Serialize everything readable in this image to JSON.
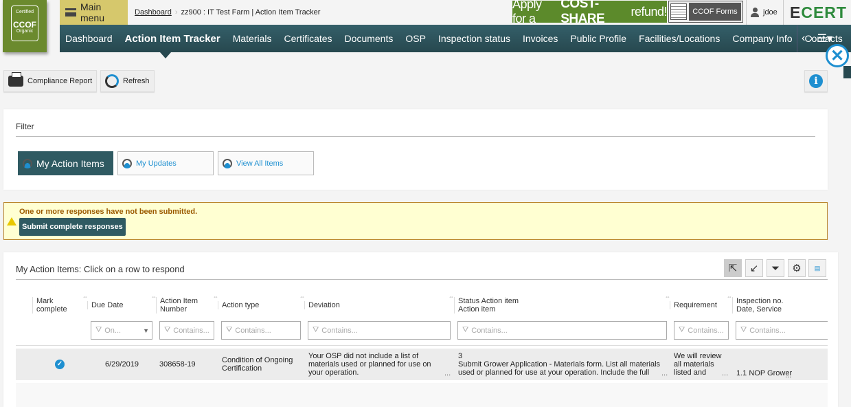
{
  "logo": {
    "top": "Certified",
    "name": "CCOF",
    "bottom": "Organic"
  },
  "header": {
    "main_menu": "Main menu",
    "breadcrumb": {
      "link": "Dashboard",
      "current": "zz900 : IT Test Farm | Action Item Tracker"
    },
    "costshare": {
      "pre": "Apply for a",
      "bold": "COST-SHARE",
      "post": "refund!"
    },
    "forms": "CCOF Forms",
    "user": "jdoe",
    "brand": {
      "e": "E",
      "rest": "CERT"
    }
  },
  "nav": {
    "items": [
      "Dashboard",
      "Action Item Tracker",
      "Materials",
      "Certificates",
      "Documents",
      "OSP",
      "Inspection status",
      "Invoices",
      "Public Profile",
      "Facilities/Locations",
      "Company Info",
      "Contacts"
    ],
    "active": "Action Item Tracker"
  },
  "toolbar": {
    "compliance": "Compliance Report",
    "refresh": "Refresh"
  },
  "filter": {
    "title": "Filter",
    "buttons": [
      "My Action Items",
      "My Updates",
      "View All Items"
    ],
    "active": "My Action Items"
  },
  "warning": {
    "message": "One or more responses have not been submitted.",
    "button": "Submit complete responses"
  },
  "grid": {
    "title": "My Action Items: Click on a row to respond",
    "headers": [
      [
        "Mark",
        "complete"
      ],
      [
        "Due Date",
        ""
      ],
      [
        "Action Item",
        "Number"
      ],
      [
        "Action type",
        ""
      ],
      [
        "Deviation",
        ""
      ],
      [
        "Status Action item",
        "Action item"
      ],
      [
        "Requirement",
        ""
      ],
      [
        "Inspection no.",
        "Date, Service"
      ]
    ],
    "filters": [
      "On...",
      "Contains...",
      "Contains...",
      "Contains...",
      "Contains...",
      "Contains...",
      "Contains..."
    ],
    "rows": [
      {
        "complete": true,
        "due": "6/29/2019",
        "number": "308658-19",
        "type": "Condition of Ongoing Certification",
        "deviation": "Your OSP did not include a list of materials used or planned for use on your operation.",
        "status": "3",
        "action": "Submit Grower Application - Materials form. List all materials used or planned for use at your operation. Include the full",
        "requirement": "We will review all materials listed and",
        "inspection": "1.1 NOP Grower"
      }
    ]
  },
  "colors": {
    "nav": "#2f5a62",
    "menu": "#d6c86c",
    "accent": "#1e8fd0",
    "warning_bg": "#ffffd2",
    "brand_green": "#2e8a3c"
  }
}
